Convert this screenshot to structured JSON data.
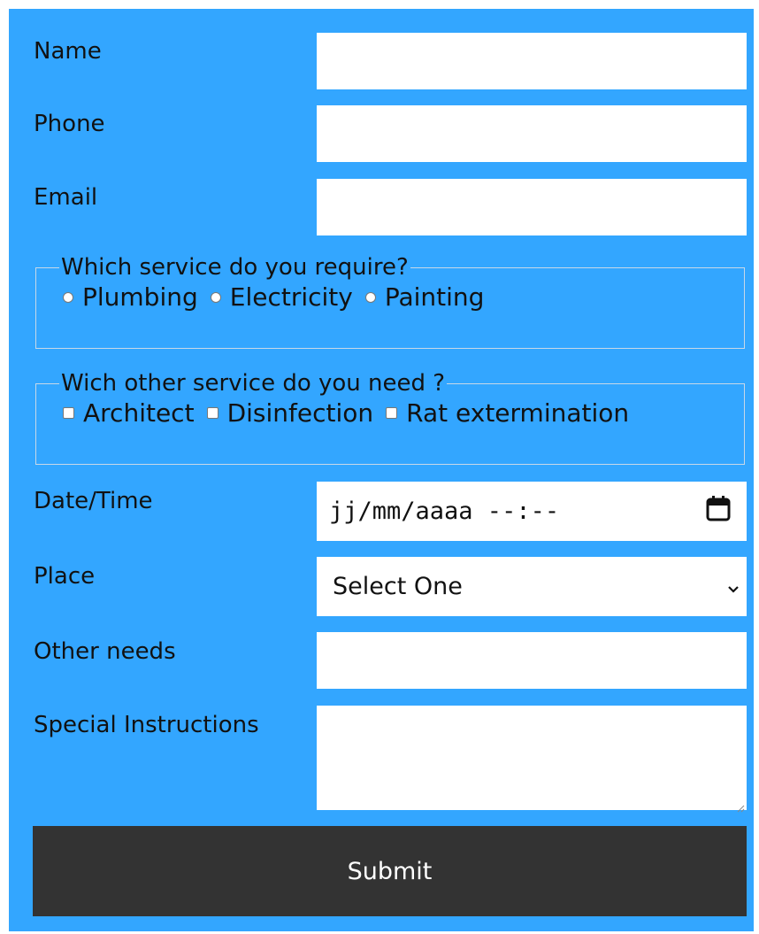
{
  "form": {
    "name_label": "Name",
    "phone_label": "Phone",
    "email_label": "Email",
    "service_legend": "Which service do you require?",
    "services": [
      "Plumbing",
      "Electricity",
      "Painting"
    ],
    "other_legend": "Wich other service do you need ?",
    "others": [
      "Architect",
      "Disinfection",
      "Rat extermination"
    ],
    "datetime_label": "Date/Time",
    "datetime_placeholder": "jj/mm/aaaa --:--",
    "place_label": "Place",
    "place_selected": "Select One",
    "other_needs_label": "Other needs",
    "special_label": "Special Instructions",
    "submit_label": "Submit"
  },
  "colors": {
    "form_bg": "#33a6ff",
    "submit_bg": "#333333",
    "submit_text": "#ffffff"
  },
  "icons": {
    "calendar": "calendar-icon",
    "dropdown": "chevron-down-icon"
  }
}
